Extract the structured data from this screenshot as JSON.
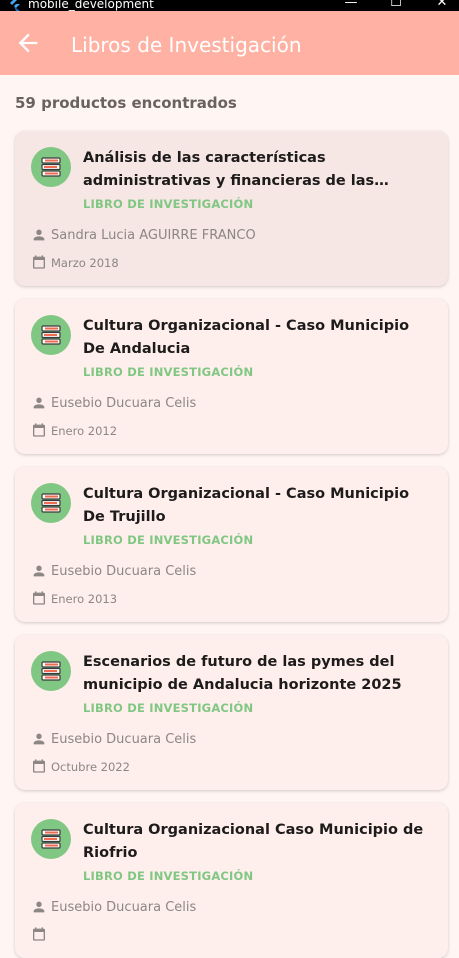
{
  "window": {
    "title": "mobile_development",
    "minimize": "—",
    "maximize": "☐",
    "close": "✕"
  },
  "appbar": {
    "title": "Libros de Investigación"
  },
  "results": {
    "count_text": "59 productos encontrados"
  },
  "colors": {
    "appbar": "#ffb2a3",
    "background": "#fff5f3",
    "card": "#ffefec",
    "accent_green": "#81c784"
  },
  "cards": [
    {
      "title": "Análisis de las características administrativas y financieras de las empresas del sector co...",
      "type": "LIBRO DE INVESTIGACIÓN",
      "author": "Sandra Lucia AGUIRRE FRANCO",
      "date": "Marzo 2018",
      "icon": "book-stack-icon"
    },
    {
      "title": "Cultura Organizacional - Caso Municipio De Andalucia",
      "type": "LIBRO DE INVESTIGACIÓN",
      "author": "Eusebio Ducuara Celis",
      "date": "Enero 2012",
      "icon": "book-stack-icon"
    },
    {
      "title": "Cultura Organizacional - Caso Municipio De Trujillo",
      "type": "LIBRO DE INVESTIGACIÓN",
      "author": "Eusebio Ducuara Celis",
      "date": "Enero 2013",
      "icon": "book-stack-icon"
    },
    {
      "title": "Escenarios de futuro de las pymes del municipio de Andalucia horizonte 2025",
      "type": "LIBRO DE INVESTIGACIÓN",
      "author": "Eusebio Ducuara Celis",
      "date": "Octubre 2022",
      "icon": "book-stack-icon"
    },
    {
      "title": "Cultura Organizacional Caso Municipio de Riofrio",
      "type": "LIBRO DE INVESTIGACIÓN",
      "author": "Eusebio Ducuara Celis",
      "date": "",
      "icon": "book-stack-icon"
    }
  ]
}
